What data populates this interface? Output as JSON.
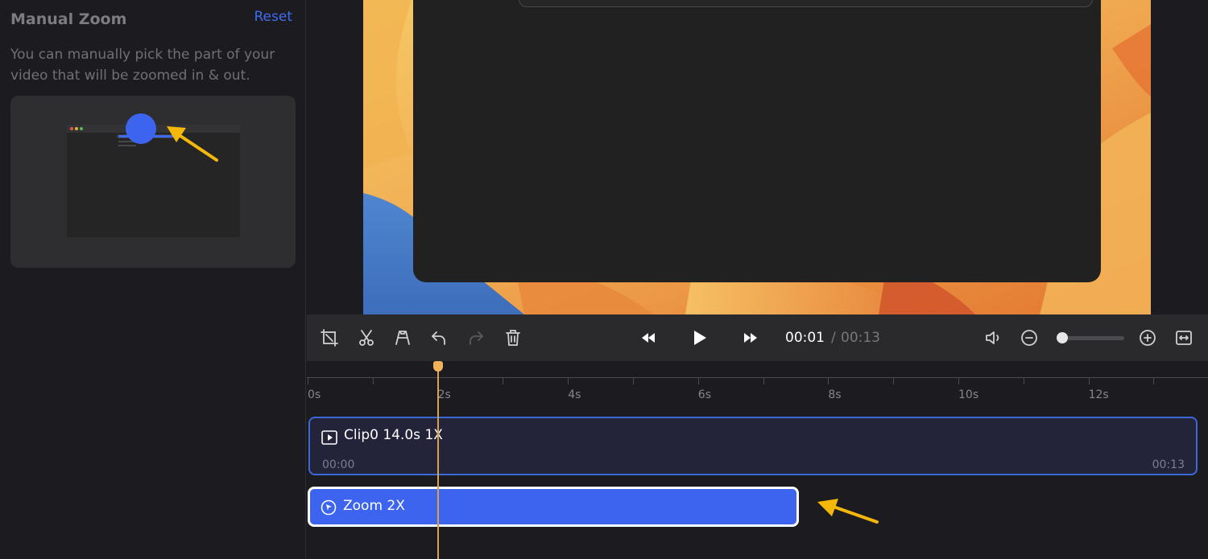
{
  "panel": {
    "title": "Manual Zoom",
    "reset_label": "Reset",
    "description": "You can manually pick the part of your video that will be zoomed in & out."
  },
  "player": {
    "current_time": "00:01",
    "separator": "/",
    "total_time": "00:13",
    "zoom_level": 0.05
  },
  "toolbar": {
    "left_tools": [
      "crop-icon",
      "cut-icon",
      "speed-icon",
      "undo-icon",
      "redo-icon",
      "delete-icon"
    ],
    "transport": [
      "rewind-icon",
      "play-icon",
      "fast-forward-icon"
    ],
    "right_tools": [
      "volume-icon",
      "zoom-out-icon",
      "zoom-in-icon",
      "fit-width-icon"
    ]
  },
  "timeline": {
    "ticks": [
      "0s",
      "2s",
      "4s",
      "6s",
      "8s",
      "10s",
      "12s"
    ],
    "playhead_time": 2,
    "clip": {
      "label": "Clip0 14.0s 1X",
      "start": "00:00",
      "end": "00:13"
    },
    "zoom_segment": {
      "label": "Zoom 2X"
    }
  },
  "colors": {
    "accent": "#3c64ee",
    "playhead": "#f0b45c",
    "annotation_arrow": "#f5b80a"
  }
}
